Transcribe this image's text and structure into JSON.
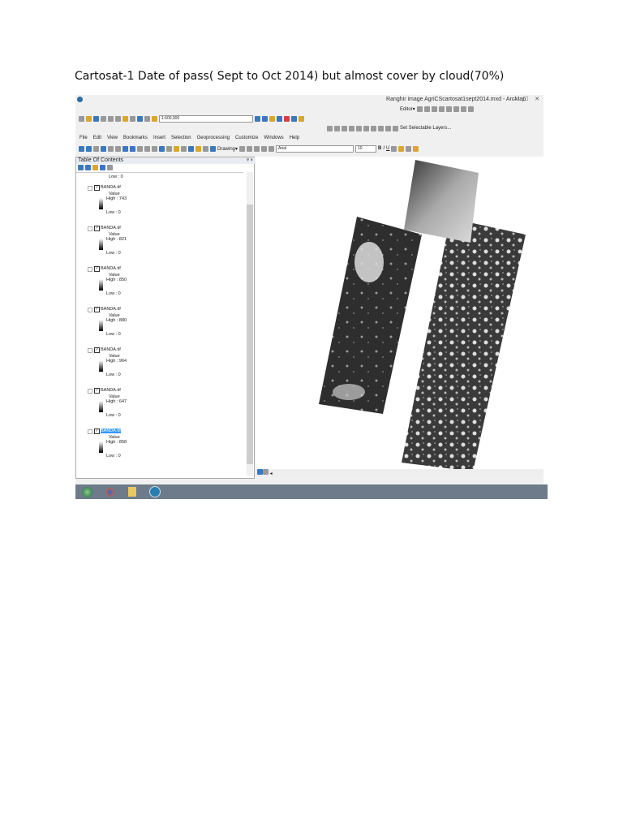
{
  "caption": "Cartosat-1 Date of pass( Sept to Oct 2014) but almost cover by cloud(70%)",
  "window": {
    "title": "Ranghir image AgriCScartosat1sept2014.mxd - ArcMap",
    "controls": "– ☐ ✕"
  },
  "toolbar": {
    "scale": "1:600,000",
    "editor": "Editor▾",
    "selectable": "Set Selectable Layers...",
    "drawing": "Drawing▾",
    "font": "Arial",
    "font_size": "10",
    "bold": "B",
    "italic": "I",
    "underline": "U"
  },
  "menu": [
    "File",
    "Edit",
    "View",
    "Bookmarks",
    "Insert",
    "Selection",
    "Geoprocessing",
    "Customize",
    "Windows",
    "Help"
  ],
  "toc": {
    "title": "Table Of Contents",
    "close": "ᵠ ×",
    "top_low": "Low : 0",
    "layers": [
      {
        "name": "BANDA.tif",
        "value": "Value",
        "high": "High : 743",
        "low": "Low : 0"
      },
      {
        "name": "BANDA.tif",
        "value": "Value",
        "high": "High : 821",
        "low": "Low : 0"
      },
      {
        "name": "BANDA.tif",
        "value": "Value",
        "high": "High : 850",
        "low": "Low : 0"
      },
      {
        "name": "BANDA.tif",
        "value": "Value",
        "high": "High : 880",
        "low": "Low : 0"
      },
      {
        "name": "BANDA.tif",
        "value": "Value",
        "high": "High : 964",
        "low": "Low : 0"
      },
      {
        "name": "BANDA.tif",
        "value": "Value",
        "high": "High : 647",
        "low": "Low : 0"
      },
      {
        "name": "BANDA.tif",
        "value": "Value",
        "high": "High : 858",
        "low": "Low : 0"
      }
    ]
  },
  "status": {
    "nav": "◂"
  }
}
